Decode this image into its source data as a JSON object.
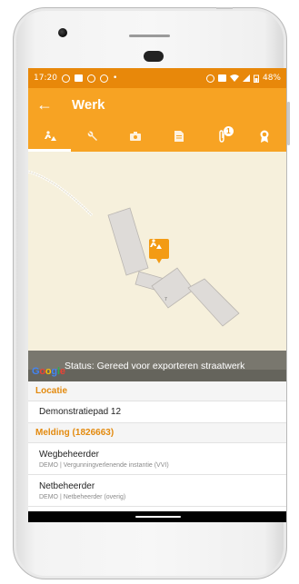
{
  "status_bar": {
    "time": "17:20",
    "battery": "48%",
    "dot": "•"
  },
  "app_bar": {
    "back_icon": "←",
    "title": "Werk"
  },
  "tabs": [
    {
      "icon": "road-worker-icon",
      "active": true
    },
    {
      "icon": "wrench-icon",
      "active": false
    },
    {
      "icon": "camera-icon",
      "active": false
    },
    {
      "icon": "document-icon",
      "active": false
    },
    {
      "icon": "paperclip-icon",
      "active": false,
      "badge": "1"
    },
    {
      "icon": "award-icon",
      "active": false
    }
  ],
  "map": {
    "status_text": "Status: Gereed voor exporteren straatwerk",
    "building_label": "7",
    "google_logo": [
      "G",
      "o",
      "o",
      "g",
      "l",
      "e"
    ]
  },
  "sections": {
    "locatie": {
      "header": "Locatie",
      "address": "Demonstratiepad 12"
    },
    "melding": {
      "header": "Melding (1826663)",
      "items": [
        {
          "title": "Wegbeheerder",
          "subtitle": "DEMO | Vergunningverlenende instantie (VVI)"
        },
        {
          "title": "Netbeheerder",
          "subtitle": "DEMO | Netbeheerder (overig)"
        }
      ]
    }
  },
  "colors": {
    "accent": "#f7a323",
    "status_bar": "#e8880a",
    "section_header_text": "#e38a0e",
    "map_background": "#f6f0dc"
  }
}
